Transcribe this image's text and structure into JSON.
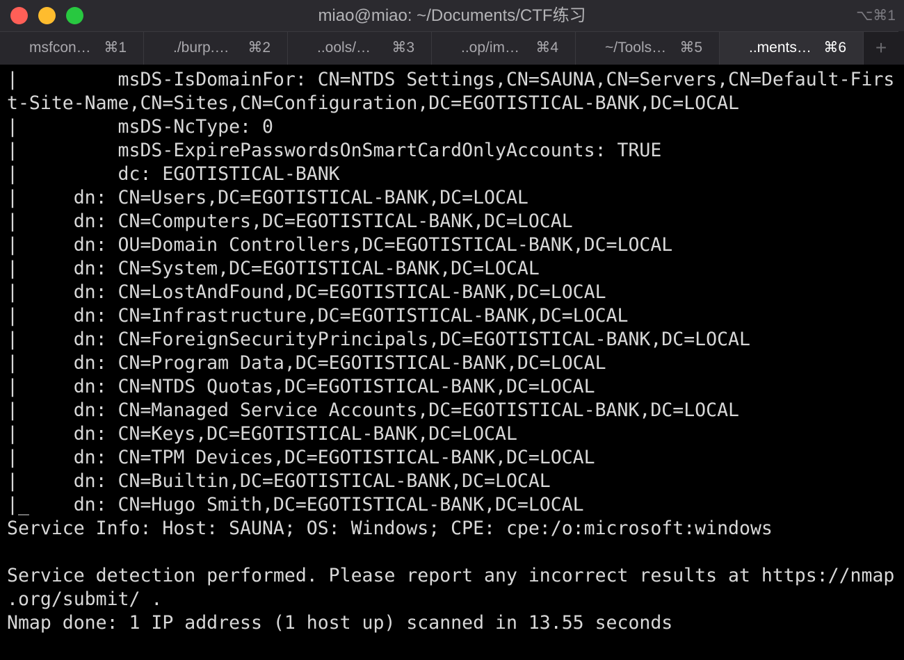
{
  "window": {
    "title": "miao@miao: ~/Documents/CTF练习",
    "shortcut": "⌥⌘1"
  },
  "tabs": [
    {
      "label": "msfcon…",
      "key": "⌘1",
      "active": false
    },
    {
      "label": "./burp.…",
      "key": "⌘2",
      "active": false
    },
    {
      "label": "..ools/…",
      "key": "⌘3",
      "active": false
    },
    {
      "label": "..op/im…",
      "key": "⌘4",
      "active": false
    },
    {
      "label": "~/Tools…",
      "key": "⌘5",
      "active": false
    },
    {
      "label": "..ments…",
      "key": "⌘6",
      "active": true
    }
  ],
  "new_tab_label": "+",
  "terminal": {
    "lines": [
      "|         msDS-IsDomainFor: CN=NTDS Settings,CN=SAUNA,CN=Servers,CN=Default-Firs",
      "t-Site-Name,CN=Sites,CN=Configuration,DC=EGOTISTICAL-BANK,DC=LOCAL",
      "|         msDS-NcType: 0",
      "|         msDS-ExpirePasswordsOnSmartCardOnlyAccounts: TRUE",
      "|         dc: EGOTISTICAL-BANK",
      "|     dn: CN=Users,DC=EGOTISTICAL-BANK,DC=LOCAL",
      "|     dn: CN=Computers,DC=EGOTISTICAL-BANK,DC=LOCAL",
      "|     dn: OU=Domain Controllers,DC=EGOTISTICAL-BANK,DC=LOCAL",
      "|     dn: CN=System,DC=EGOTISTICAL-BANK,DC=LOCAL",
      "|     dn: CN=LostAndFound,DC=EGOTISTICAL-BANK,DC=LOCAL",
      "|     dn: CN=Infrastructure,DC=EGOTISTICAL-BANK,DC=LOCAL",
      "|     dn: CN=ForeignSecurityPrincipals,DC=EGOTISTICAL-BANK,DC=LOCAL",
      "|     dn: CN=Program Data,DC=EGOTISTICAL-BANK,DC=LOCAL",
      "|     dn: CN=NTDS Quotas,DC=EGOTISTICAL-BANK,DC=LOCAL",
      "|     dn: CN=Managed Service Accounts,DC=EGOTISTICAL-BANK,DC=LOCAL",
      "|     dn: CN=Keys,DC=EGOTISTICAL-BANK,DC=LOCAL",
      "|     dn: CN=TPM Devices,DC=EGOTISTICAL-BANK,DC=LOCAL",
      "|     dn: CN=Builtin,DC=EGOTISTICAL-BANK,DC=LOCAL",
      "|_    dn: CN=Hugo Smith,DC=EGOTISTICAL-BANK,DC=LOCAL",
      "Service Info: Host: SAUNA; OS: Windows; CPE: cpe:/o:microsoft:windows",
      "",
      "Service detection performed. Please report any incorrect results at https://nmap",
      ".org/submit/ .",
      "Nmap done: 1 IP address (1 host up) scanned in 13.55 seconds"
    ]
  }
}
